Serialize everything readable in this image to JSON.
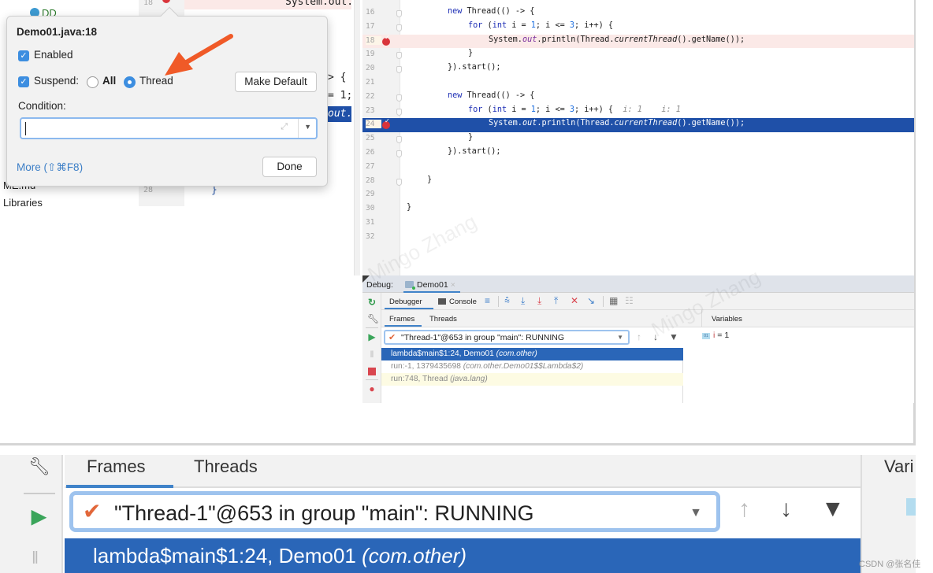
{
  "project_tree": {
    "items": [
      "DD",
      "ME.md",
      "Libraries"
    ]
  },
  "editor_left_fragments": {
    "line18_num": "18",
    "line28_num": "28",
    "code_top": "System.out.",
    "code_brace": "> {",
    "code_assign": "= 1;",
    "code_out": "out.",
    "code_close": "}"
  },
  "editor": {
    "lines": [
      {
        "num": "16",
        "code": "new Thread(() -> {"
      },
      {
        "num": "17",
        "code": "for (int i = 1; i <= 3; i++) {"
      },
      {
        "num": "18",
        "code": "System.out.println(Thread.currentThread().getName());",
        "breakpoint": true
      },
      {
        "num": "19",
        "code": "}"
      },
      {
        "num": "20",
        "code": "}).start();"
      },
      {
        "num": "21",
        "code": ""
      },
      {
        "num": "22",
        "code": "new Thread(() -> {"
      },
      {
        "num": "23",
        "code": "for (int i = 1; i <= 3; i++) {",
        "inline_hint": "i: 1    i: 1"
      },
      {
        "num": "24",
        "code": "System.out.println(Thread.currentThread().getName());",
        "breakpoint": true,
        "execution_point": true
      },
      {
        "num": "25",
        "code": "}"
      },
      {
        "num": "26",
        "code": "}).start();"
      },
      {
        "num": "27",
        "code": ""
      },
      {
        "num": "28",
        "code": "}"
      },
      {
        "num": "29",
        "code": ""
      },
      {
        "num": "30",
        "code": "}"
      },
      {
        "num": "31",
        "code": ""
      },
      {
        "num": "32",
        "code": ""
      }
    ]
  },
  "breakpoint_popup": {
    "title": "Demo01.java:18",
    "enabled_label": "Enabled",
    "enabled_checked": true,
    "suspend_label": "Suspend:",
    "suspend_checked": true,
    "suspend_options": [
      "All",
      "Thread"
    ],
    "suspend_selected": "Thread",
    "make_default_label": "Make Default",
    "condition_label": "Condition:",
    "condition_value": "",
    "more_label": "More (⇧⌘F8)",
    "done_label": "Done"
  },
  "debug_panel": {
    "title": "Debug:",
    "session_tab": "Demo01",
    "tabs": [
      "Debugger",
      "Console"
    ],
    "active_tab": "Debugger",
    "sub_tabs": [
      "Frames",
      "Threads"
    ],
    "active_sub_tab": "Frames",
    "variables_header": "Variables",
    "thread_selector": "\"Thread-1\"@653 in group \"main\": RUNNING",
    "frames": [
      {
        "method": "lambda$main$1:24, Demo01",
        "pkg": "(com.other)",
        "selected": true
      },
      {
        "method": "run:-1, 1379435698",
        "pkg": "(com.other.Demo01$$Lambda$2)"
      },
      {
        "method": "run:748, Thread",
        "pkg": "(java.lang)"
      }
    ],
    "variables": [
      {
        "type_icon": "01",
        "name": "i",
        "value": "= 1"
      }
    ]
  },
  "zoomed_crop": {
    "sub_tabs": [
      "Frames",
      "Threads"
    ],
    "variables_header_partial": "Vari",
    "thread_selector": "\"Thread-1\"@653 in group \"main\": RUNNING",
    "selected_frame_method": "lambda$main$1:24, Demo01",
    "selected_frame_pkg": "(com.other)"
  },
  "watermark": {
    "text": "Mingo Zhang",
    "credit": "CSDN @张名佳"
  },
  "colors": {
    "accent_blue": "#3d8ee0",
    "execution_line": "#1f50a8",
    "selected_frame": "#2a66b8",
    "breakpoint_red": "#d9343a",
    "annotation_arrow": "#f05a28"
  }
}
